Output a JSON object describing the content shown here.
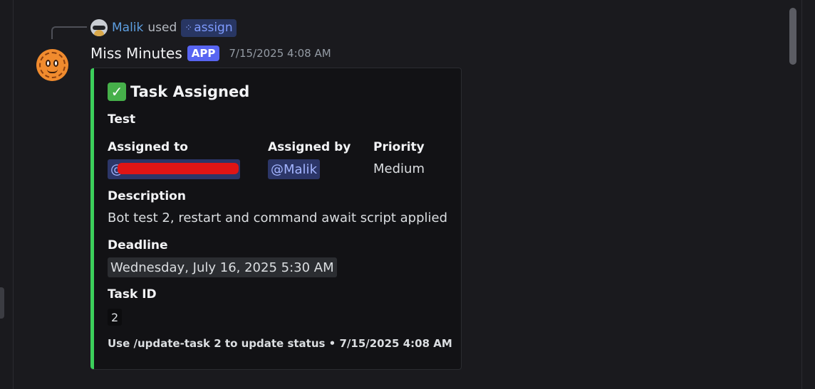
{
  "reply": {
    "user": "Malik",
    "used_text": "used",
    "command": "assign"
  },
  "message": {
    "username": "Miss Minutes",
    "badge": "APP",
    "timestamp": "7/15/2025 4:08 AM"
  },
  "embed": {
    "accent_color": "#3ccf5b",
    "title_emoji": "✓",
    "title": "Task Assigned",
    "description": "Test",
    "fields": {
      "assigned_to_label": "Assigned to",
      "assigned_to_value": "@",
      "assigned_by_label": "Assigned by",
      "assigned_by_value": "@Malik",
      "priority_label": "Priority",
      "priority_value": "Medium",
      "description_label": "Description",
      "description_value": "Bot test 2, restart and command await script applied",
      "deadline_label": "Deadline",
      "deadline_value": "Wednesday, July 16, 2025 5:30 AM",
      "task_id_label": "Task ID",
      "task_id_value": "2"
    },
    "footer": "Use /update-task 2 to update status • 7/15/2025 4:08 AM"
  },
  "icons": {
    "check": "white-check-mark-icon",
    "command": "slash-command-icon"
  },
  "colors": {
    "background": "#1a1a1e",
    "mention_bg": "#2c3668",
    "app_badge": "#5865f2"
  }
}
